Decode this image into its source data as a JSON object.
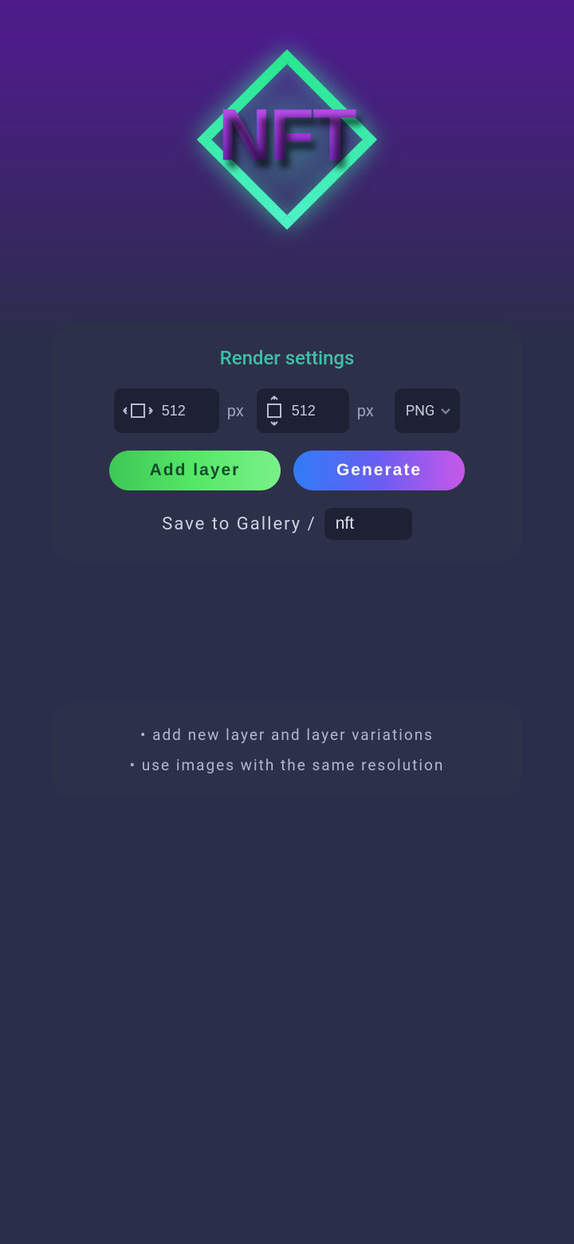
{
  "logo": {
    "text": "NFT"
  },
  "panel": {
    "title": "Render settings",
    "width": {
      "value": "512",
      "unit": "px"
    },
    "height": {
      "value": "512",
      "unit": "px"
    },
    "format": {
      "selected": "PNG"
    },
    "add_layer_label": "Add layer",
    "generate_label": "Generate",
    "save_label": "Save to Gallery /",
    "save_value": "nft"
  },
  "tips": {
    "line1": "• add new layer and layer variations",
    "line2": "• use images with the same resolution"
  }
}
